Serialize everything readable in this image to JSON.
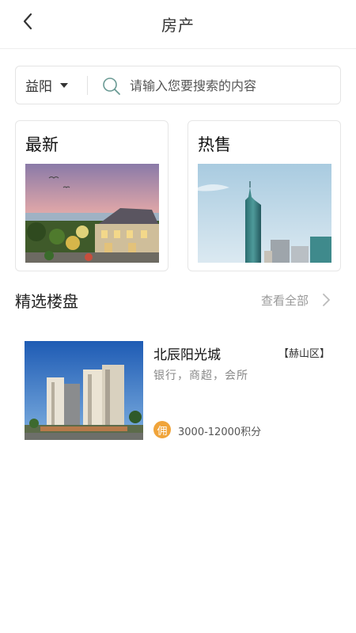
{
  "header": {
    "title": "房产",
    "back_icon": "chevron-left-icon"
  },
  "search": {
    "city": "益阳",
    "placeholder": "请输入您要搜索的内容",
    "icon": "search-icon"
  },
  "categories": [
    {
      "label": "最新",
      "image": "villa-at-sunset-image"
    },
    {
      "label": "热售",
      "image": "skyscraper-image"
    }
  ],
  "featured": {
    "title": "精选楼盘",
    "view_all": "查看全部",
    "view_all_icon": "chevron-right-icon"
  },
  "listings": [
    {
      "name": "北辰阳光城",
      "district": "【赫山区】",
      "tags": "银行，商超，会所",
      "badge": "佣",
      "points": "3000-12000积分",
      "image": "high-rise-towers-image"
    }
  ],
  "colors": {
    "badge": "#f0a43a",
    "muted": "#999999",
    "border": "#e6e6e6"
  }
}
